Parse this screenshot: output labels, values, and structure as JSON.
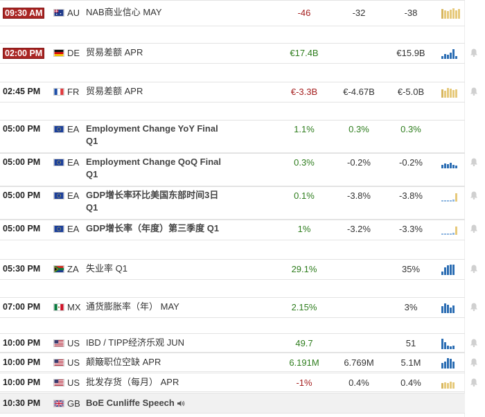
{
  "colors": {
    "positive": "#2e7d1d",
    "negative": "#a51e1e",
    "badge": "#a92523",
    "bar_blue": "#2b6db3",
    "bar_light_blue": "#8eb6e0",
    "bar_gold": "#e6c97a"
  },
  "events": [
    {
      "time": "09:30 AM",
      "highlight": true,
      "country": "AU",
      "flag": "au-flag-icon",
      "event": "NAB商业信心 MAY",
      "bold": false,
      "actual": "-46",
      "actual_tone": "negative",
      "forecast": "-32",
      "previous": "-38",
      "chart": "gold-bars-icon",
      "bell": false
    },
    {
      "time": "02:00 PM",
      "highlight": true,
      "country": "DE",
      "flag": "de-flag-icon",
      "event": "贸易差额 APR",
      "bold": false,
      "actual": "€17.4B",
      "actual_tone": "positive",
      "forecast": "",
      "previous": "€15.9B",
      "chart": "blue-bars-icon",
      "bell": true
    },
    {
      "time": "02:45 PM",
      "highlight": false,
      "country": "FR",
      "flag": "fr-flag-icon",
      "event": "贸易差额 APR",
      "bold": false,
      "actual": "€-3.3B",
      "actual_tone": "negative",
      "forecast": "€-4.67B",
      "previous": "€-5.0B",
      "chart": "gold-bars-icon",
      "bell": true
    },
    {
      "time": "05:00 PM",
      "highlight": false,
      "country": "EA",
      "flag": "eu-flag-icon",
      "event": "Employment Change YoY Final Q1",
      "bold": true,
      "actual": "1.1%",
      "actual_tone": "positive",
      "forecast": "0.3%",
      "forecast_tone": "positive",
      "previous": "0.3%",
      "previous_tone": "positive",
      "chart": "none",
      "bell": false
    },
    {
      "time": "05:00 PM",
      "highlight": false,
      "country": "EA",
      "flag": "eu-flag-icon",
      "event": "Employment Change QoQ Final Q1",
      "bold": true,
      "actual": "0.3%",
      "actual_tone": "positive",
      "forecast": "-0.2%",
      "previous": "-0.2%",
      "chart": "blue-bars-icon",
      "bell": true
    },
    {
      "time": "05:00 PM",
      "highlight": false,
      "country": "EA",
      "flag": "eu-flag-icon",
      "event": "GDP增长率环比美国东部时间3日 Q1",
      "bold": true,
      "actual": "0.1%",
      "actual_tone": "positive",
      "forecast": "-3.8%",
      "previous": "-3.8%",
      "chart": "mixed-bars-icon",
      "bell": true
    },
    {
      "time": "05:00 PM",
      "highlight": false,
      "country": "EA",
      "flag": "eu-flag-icon",
      "event": "GDP增长率（年度）第三季度 Q1",
      "bold": true,
      "actual": "1%",
      "actual_tone": "positive",
      "forecast": "-3.2%",
      "previous": "-3.3%",
      "chart": "mixed-bars-icon",
      "bell": true
    },
    {
      "time": "05:30 PM",
      "highlight": false,
      "country": "ZA",
      "flag": "za-flag-icon",
      "event": "失业率 Q1",
      "bold": false,
      "actual": "29.1%",
      "actual_tone": "positive",
      "forecast": "",
      "previous": "35%",
      "chart": "blue-bars-icon",
      "bell": true
    },
    {
      "time": "07:00 PM",
      "highlight": false,
      "country": "MX",
      "flag": "mx-flag-icon",
      "event": "通货膨胀率（年） MAY",
      "bold": false,
      "actual": "2.15%",
      "actual_tone": "positive",
      "forecast": "",
      "previous": "3%",
      "chart": "blue-bars-icon",
      "bell": true
    },
    {
      "time": "10:00 PM",
      "highlight": false,
      "country": "US",
      "flag": "us-flag-icon",
      "event": "IBD / TIPP经济乐观 JUN",
      "bold": false,
      "actual": "49.7",
      "actual_tone": "positive",
      "forecast": "",
      "previous": "51",
      "chart": "blue-bars-icon",
      "bell": true
    },
    {
      "time": "10:00 PM",
      "highlight": false,
      "country": "US",
      "flag": "us-flag-icon",
      "event": "颠簸职位空缺 APR",
      "bold": false,
      "actual": "6.191M",
      "actual_tone": "positive",
      "forecast": "6.769M",
      "previous": "5.1M",
      "chart": "blue-bars-icon",
      "bell": true
    },
    {
      "time": "10:00 PM",
      "highlight": false,
      "country": "US",
      "flag": "us-flag-icon",
      "event": "批发存货（每月） APR",
      "bold": false,
      "actual": "-1%",
      "actual_tone": "negative",
      "forecast": "0.4%",
      "previous": "0.4%",
      "chart": "gold-bars-icon",
      "bell": true
    },
    {
      "time": "10:30 PM",
      "highlight": false,
      "country": "GB",
      "flag": "gb-flag-icon",
      "event": "BoE Cunliffe Speech",
      "bold": true,
      "speaker": true,
      "actual": "",
      "forecast": "",
      "previous": "",
      "chart": "none",
      "bell": false
    }
  ]
}
